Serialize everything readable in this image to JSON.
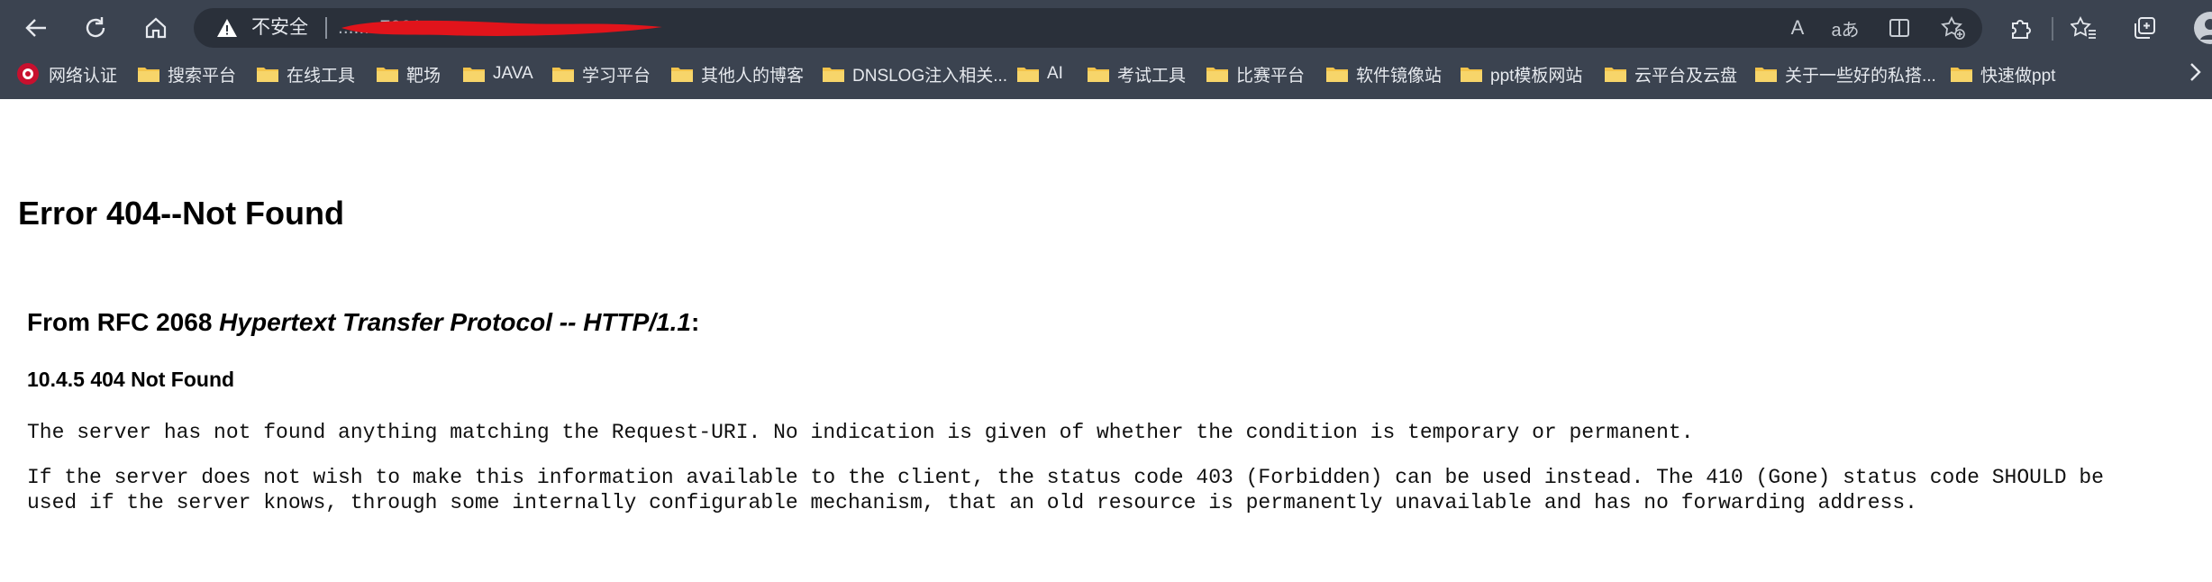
{
  "browser": {
    "insecure_label": "不安全",
    "url": ".......:7001",
    "icons": {
      "back": "arrow-left",
      "refresh": "refresh",
      "home": "home",
      "read_aloud": "read-aloud",
      "translate": "translate",
      "split_screen": "split-screen",
      "favorite": "star-plus",
      "extensions": "puzzle",
      "favorites": "star-list",
      "collections": "collections",
      "profile": "profile"
    },
    "read_aloud_glyph": "A",
    "translate_glyph": "aあ"
  },
  "bookmarks": [
    {
      "label": "网络认证",
      "type": "site"
    },
    {
      "label": "搜索平台",
      "type": "folder"
    },
    {
      "label": "在线工具",
      "type": "folder"
    },
    {
      "label": "靶场",
      "type": "folder"
    },
    {
      "label": "JAVA",
      "type": "folder"
    },
    {
      "label": "学习平台",
      "type": "folder"
    },
    {
      "label": "其他人的博客",
      "type": "folder"
    },
    {
      "label": "DNSLOG注入相关...",
      "type": "folder"
    },
    {
      "label": "AI",
      "type": "folder"
    },
    {
      "label": "考试工具",
      "type": "folder"
    },
    {
      "label": "比赛平台",
      "type": "folder"
    },
    {
      "label": "软件镜像站",
      "type": "folder"
    },
    {
      "label": "ppt模板网站",
      "type": "folder"
    },
    {
      "label": "云平台及云盘",
      "type": "folder"
    },
    {
      "label": "关于一些好的私搭...",
      "type": "folder"
    },
    {
      "label": "快速做ppt",
      "type": "folder"
    }
  ],
  "colors": {
    "chrome": "#3b4350",
    "address_bar": "#2a303a",
    "folder": "#f3c44b",
    "redaction": "#e1141b"
  },
  "page": {
    "title": "Error 404--Not Found",
    "rfc_prefix": "From RFC 2068 ",
    "rfc_title": "Hypertext Transfer Protocol -- HTTP/1.1",
    "rfc_suffix": ":",
    "section": "10.4.5 404 Not Found",
    "para1": "The server has not found anything matching the Request-URI. No indication is given of whether the condition is temporary or permanent.",
    "para2_line1": "If the server does not wish to make this information available to the client, the status code 403 (Forbidden) can be used instead. The 410 (Gone) status code SHOULD be",
    "para2_line2": "used if the server knows, through some internally configurable mechanism, that an old resource is permanently unavailable and has no forwarding address."
  }
}
